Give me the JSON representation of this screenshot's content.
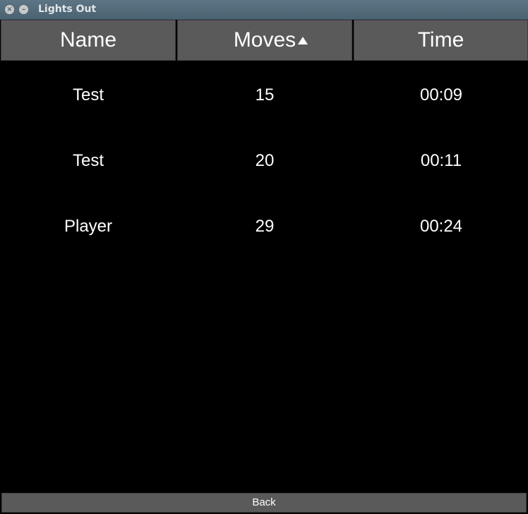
{
  "window": {
    "title": "Lights Out",
    "close_glyph": "×",
    "minimize_glyph": "–"
  },
  "table": {
    "columns": [
      {
        "label": "Name"
      },
      {
        "label": "Moves",
        "sorted": "ascending"
      },
      {
        "label": "Time"
      }
    ],
    "rows": [
      {
        "name": "Test",
        "moves": "15",
        "time": "00:09"
      },
      {
        "name": "Test",
        "moves": "20",
        "time": "00:11"
      },
      {
        "name": "Player",
        "moves": "29",
        "time": "00:24"
      }
    ]
  },
  "footer": {
    "back_label": "Back"
  },
  "colors": {
    "titlebar": "#4b6271",
    "header_bg": "#5a5a5a",
    "background": "#000000",
    "text": "#ffffff"
  }
}
